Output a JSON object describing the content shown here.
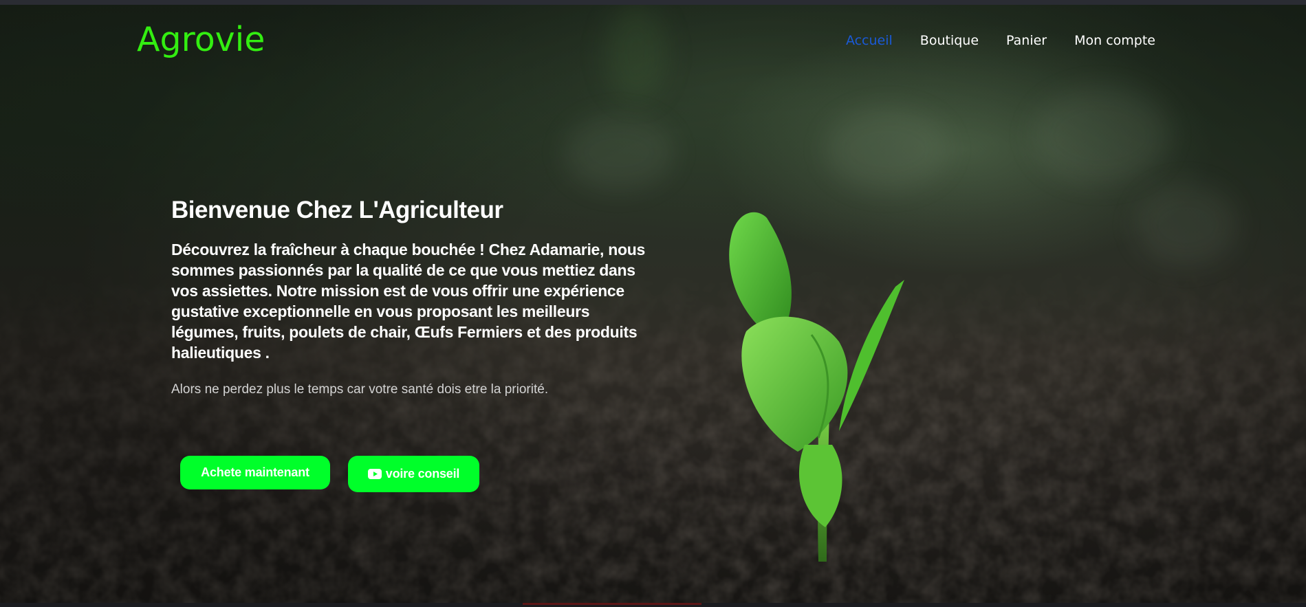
{
  "brand": {
    "name": "Agrovie",
    "color": "#33ee11"
  },
  "nav": {
    "items": [
      {
        "label": "Accueil",
        "active": true
      },
      {
        "label": "Boutique",
        "active": false
      },
      {
        "label": "Panier",
        "active": false
      },
      {
        "label": "Mon compte",
        "active": false
      }
    ],
    "active_color": "#1a5ad8"
  },
  "hero": {
    "title": "Bienvenue Chez L'Agriculteur",
    "lead": "Découvrez la fraîcheur à chaque bouchée ! Chez Adamarie, nous sommes passionnés par la qualité de ce que vous mettiez  dans vos assiettes. Notre mission est de vous offrir une expérience gustative exceptionnelle en vous proposant les meilleurs légumes, fruits, poulets de chair, Œufs Fermiers et des produits halieutiques .",
    "note": "Alors ne perdez plus le temps car votre santé dois etre la priorité.",
    "buttons": {
      "buy_label": "Achete maintenant",
      "advice_label": "voire conseil",
      "advice_icon": "youtube-play-icon",
      "color": "#00ff2a"
    },
    "background": "seedling-in-soil-photo"
  }
}
